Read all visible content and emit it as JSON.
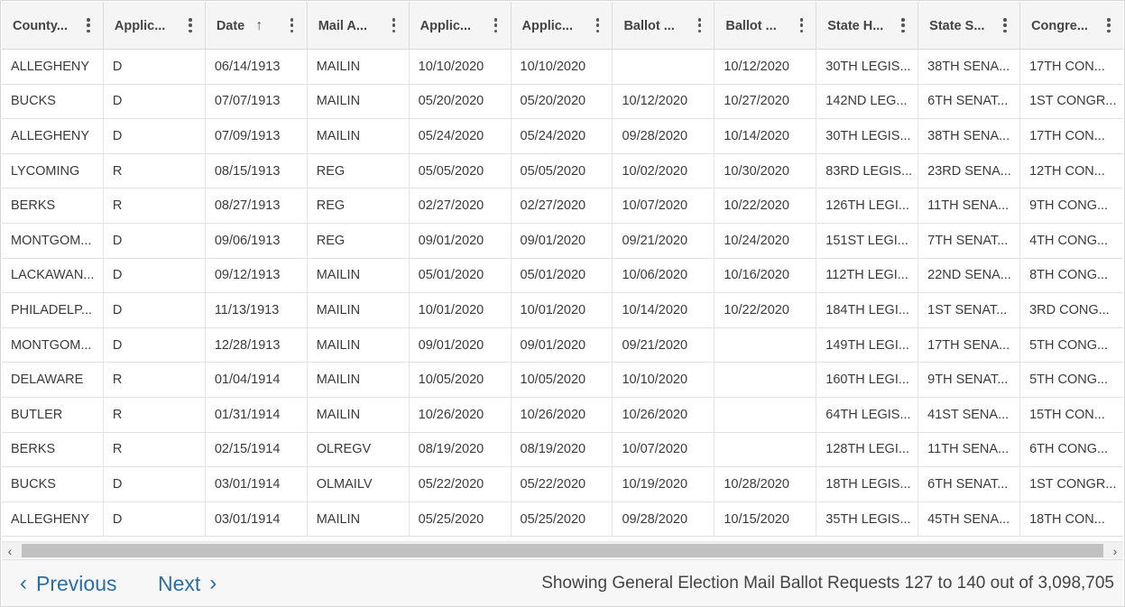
{
  "table": {
    "columns": [
      {
        "label": "County..."
      },
      {
        "label": "Applic..."
      },
      {
        "label": "Date",
        "sorted": "ascending"
      },
      {
        "label": "Mail A..."
      },
      {
        "label": "Applic..."
      },
      {
        "label": "Applic..."
      },
      {
        "label": "Ballot ..."
      },
      {
        "label": "Ballot ..."
      },
      {
        "label": "State H..."
      },
      {
        "label": "State S..."
      },
      {
        "label": "Congre..."
      }
    ],
    "rows": [
      [
        "ALLEGHENY",
        "D",
        "06/14/1913",
        "MAILIN",
        "10/10/2020",
        "10/10/2020",
        "",
        "10/12/2020",
        "30TH LEGIS...",
        "38TH SENA...",
        "17TH CON..."
      ],
      [
        "BUCKS",
        "D",
        "07/07/1913",
        "MAILIN",
        "05/20/2020",
        "05/20/2020",
        "10/12/2020",
        "10/27/2020",
        "142ND LEG...",
        "6TH SENAT...",
        "1ST CONGR..."
      ],
      [
        "ALLEGHENY",
        "D",
        "07/09/1913",
        "MAILIN",
        "05/24/2020",
        "05/24/2020",
        "09/28/2020",
        "10/14/2020",
        "30TH LEGIS...",
        "38TH SENA...",
        "17TH CON..."
      ],
      [
        "LYCOMING",
        "R",
        "08/15/1913",
        "REG",
        "05/05/2020",
        "05/05/2020",
        "10/02/2020",
        "10/30/2020",
        "83RD LEGIS...",
        "23RD SENA...",
        "12TH CON..."
      ],
      [
        "BERKS",
        "R",
        "08/27/1913",
        "REG",
        "02/27/2020",
        "02/27/2020",
        "10/07/2020",
        "10/22/2020",
        "126TH LEGI...",
        "11TH SENA...",
        "9TH CONG..."
      ],
      [
        "MONTGOM...",
        "D",
        "09/06/1913",
        "REG",
        "09/01/2020",
        "09/01/2020",
        "09/21/2020",
        "10/24/2020",
        "151ST LEGI...",
        "7TH SENAT...",
        "4TH CONG..."
      ],
      [
        "LACKAWAN...",
        "D",
        "09/12/1913",
        "MAILIN",
        "05/01/2020",
        "05/01/2020",
        "10/06/2020",
        "10/16/2020",
        "112TH LEGI...",
        "22ND SENA...",
        "8TH CONG..."
      ],
      [
        "PHILADELP...",
        "D",
        "11/13/1913",
        "MAILIN",
        "10/01/2020",
        "10/01/2020",
        "10/14/2020",
        "10/22/2020",
        "184TH LEGI...",
        "1ST SENAT...",
        "3RD CONG..."
      ],
      [
        "MONTGOM...",
        "D",
        "12/28/1913",
        "MAILIN",
        "09/01/2020",
        "09/01/2020",
        "09/21/2020",
        "",
        "149TH LEGI...",
        "17TH SENA...",
        "5TH CONG..."
      ],
      [
        "DELAWARE",
        "R",
        "01/04/1914",
        "MAILIN",
        "10/05/2020",
        "10/05/2020",
        "10/10/2020",
        "",
        "160TH LEGI...",
        "9TH SENAT...",
        "5TH CONG..."
      ],
      [
        "BUTLER",
        "R",
        "01/31/1914",
        "MAILIN",
        "10/26/2020",
        "10/26/2020",
        "10/26/2020",
        "",
        "64TH LEGIS...",
        "41ST SENA...",
        "15TH CON..."
      ],
      [
        "BERKS",
        "R",
        "02/15/1914",
        "OLREGV",
        "08/19/2020",
        "08/19/2020",
        "10/07/2020",
        "",
        "128TH LEGI...",
        "11TH SENA...",
        "6TH CONG..."
      ],
      [
        "BUCKS",
        "D",
        "03/01/1914",
        "OLMAILV",
        "05/22/2020",
        "05/22/2020",
        "10/19/2020",
        "10/28/2020",
        "18TH LEGIS...",
        "6TH SENAT...",
        "1ST CONGR..."
      ],
      [
        "ALLEGHENY",
        "D",
        "03/01/1914",
        "MAILIN",
        "05/25/2020",
        "05/25/2020",
        "09/28/2020",
        "10/15/2020",
        "35TH LEGIS...",
        "45TH SENA...",
        "18TH CON..."
      ]
    ]
  },
  "scrollbar": {
    "left_arrow": "‹",
    "right_arrow": "›"
  },
  "footer": {
    "previous_label": "Previous",
    "next_label": "Next",
    "status": "Showing General Election Mail Ballot Requests 127 to 140 out of 3,098,705"
  },
  "colors": {
    "link": "#2a6ea6",
    "header_bg": "#f5f5f5"
  }
}
